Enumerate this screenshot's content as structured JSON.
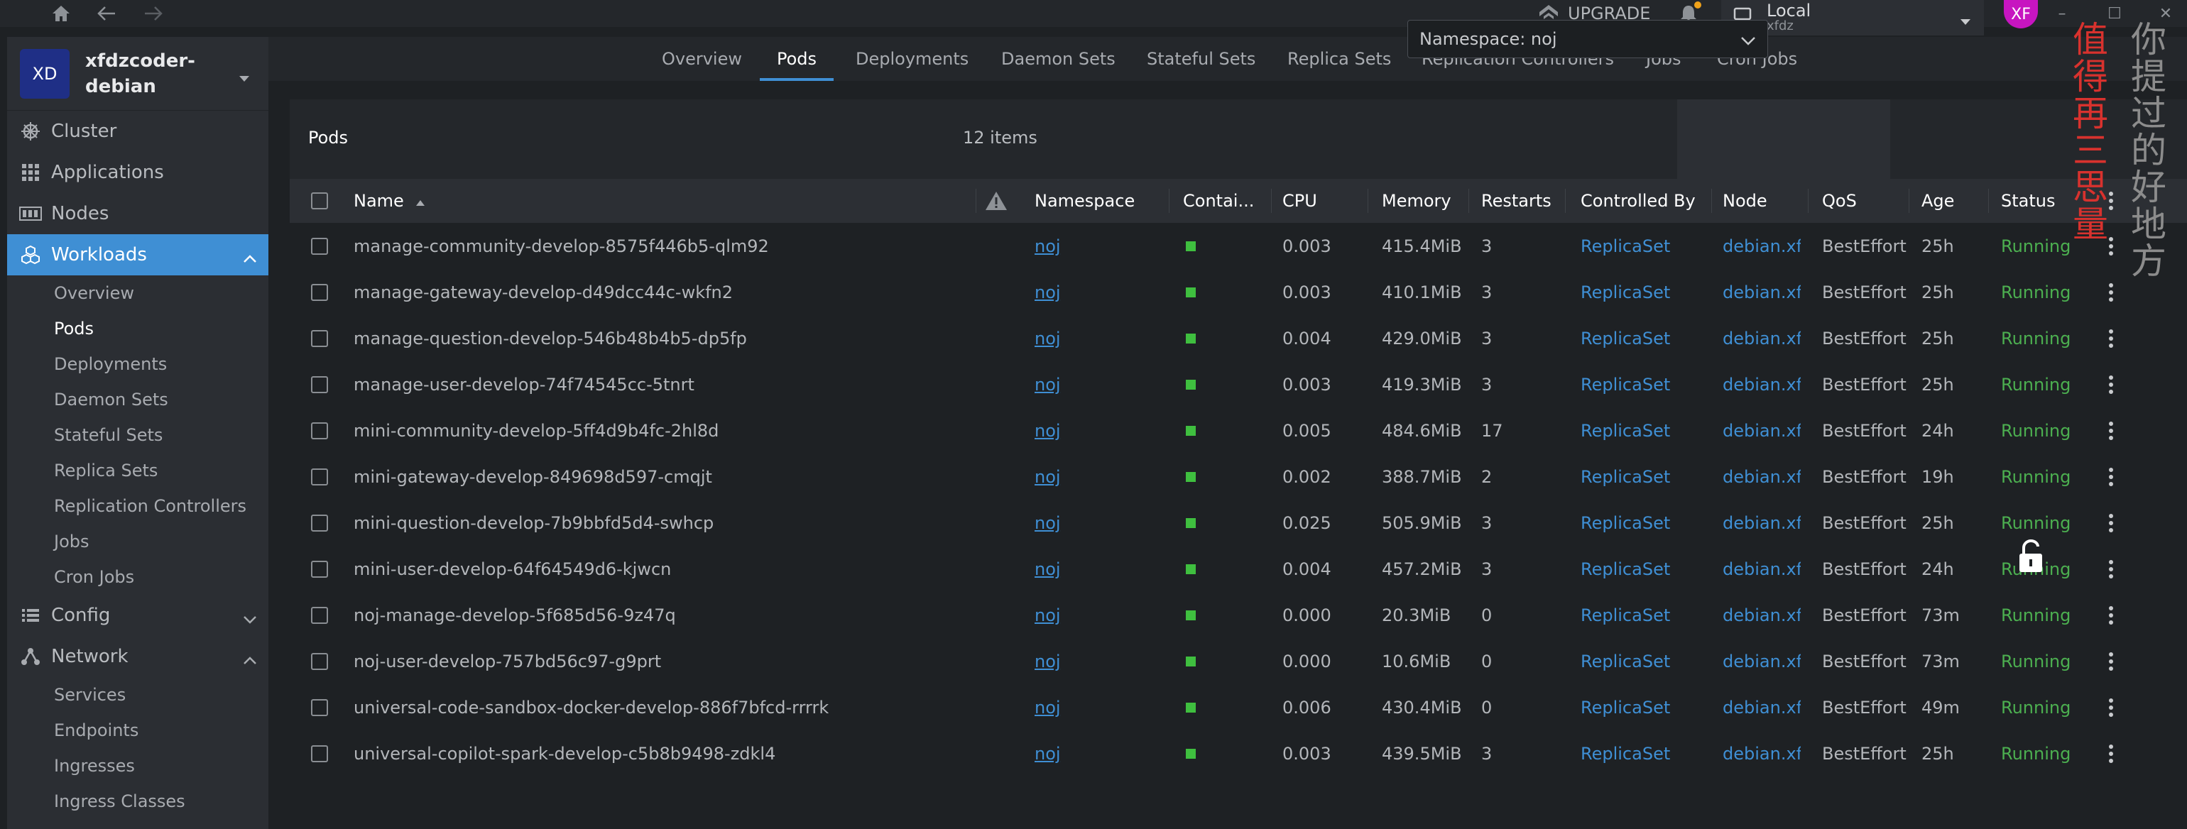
{
  "topbar": {
    "upgrade_label": "UPGRADE",
    "cluster_name": "Local",
    "cluster_user": "xfdz",
    "user_initials": "XF"
  },
  "sidebar": {
    "cluster_initials": "XD",
    "cluster_name": "xfdzcoder-debian",
    "items": [
      {
        "label": "Cluster"
      },
      {
        "label": "Applications"
      },
      {
        "label": "Nodes"
      },
      {
        "label": "Workloads"
      }
    ],
    "workloads_children": [
      {
        "label": "Overview"
      },
      {
        "label": "Pods"
      },
      {
        "label": "Deployments"
      },
      {
        "label": "Daemon Sets"
      },
      {
        "label": "Stateful Sets"
      },
      {
        "label": "Replica Sets"
      },
      {
        "label": "Replication Controllers"
      },
      {
        "label": "Jobs"
      },
      {
        "label": "Cron Jobs"
      }
    ],
    "config_label": "Config",
    "network_label": "Network",
    "network_children": [
      {
        "label": "Services"
      },
      {
        "label": "Endpoints"
      },
      {
        "label": "Ingresses"
      },
      {
        "label": "Ingress Classes"
      }
    ]
  },
  "tabs": [
    {
      "label": "Overview"
    },
    {
      "label": "Pods"
    },
    {
      "label": "Deployments"
    },
    {
      "label": "Daemon Sets"
    },
    {
      "label": "Stateful Sets"
    },
    {
      "label": "Replica Sets"
    },
    {
      "label": "Replication Controllers"
    },
    {
      "label": "Jobs"
    },
    {
      "label": "Cron Jobs"
    }
  ],
  "panel": {
    "title": "Pods",
    "count": "12 items",
    "namespace_filter": "Namespace: noj"
  },
  "columns": {
    "name": "Name",
    "namespace": "Namespace",
    "containers": "Contai...",
    "cpu": "CPU",
    "memory": "Memory",
    "restarts": "Restarts",
    "controlled_by": "Controlled By",
    "node": "Node",
    "qos": "QoS",
    "age": "Age",
    "status": "Status"
  },
  "rows": [
    {
      "name": "manage-community-develop-8575f446b5-qlm92",
      "namespace": "noj",
      "cpu": "0.003",
      "memory": "415.4MiB",
      "restarts": "3",
      "controlled_by": "ReplicaSet",
      "node": "debian.xfc",
      "qos": "BestEffort",
      "age": "25h",
      "status": "Running"
    },
    {
      "name": "manage-gateway-develop-d49dcc44c-wkfn2",
      "namespace": "noj",
      "cpu": "0.003",
      "memory": "410.1MiB",
      "restarts": "3",
      "controlled_by": "ReplicaSet",
      "node": "debian.xfc",
      "qos": "BestEffort",
      "age": "25h",
      "status": "Running"
    },
    {
      "name": "manage-question-develop-546b48b4b5-dp5fp",
      "namespace": "noj",
      "cpu": "0.004",
      "memory": "429.0MiB",
      "restarts": "3",
      "controlled_by": "ReplicaSet",
      "node": "debian.xfc",
      "qos": "BestEffort",
      "age": "25h",
      "status": "Running"
    },
    {
      "name": "manage-user-develop-74f74545cc-5tnrt",
      "namespace": "noj",
      "cpu": "0.003",
      "memory": "419.3MiB",
      "restarts": "3",
      "controlled_by": "ReplicaSet",
      "node": "debian.xfc",
      "qos": "BestEffort",
      "age": "25h",
      "status": "Running"
    },
    {
      "name": "mini-community-develop-5ff4d9b4fc-2hl8d",
      "namespace": "noj",
      "cpu": "0.005",
      "memory": "484.6MiB",
      "restarts": "17",
      "controlled_by": "ReplicaSet",
      "node": "debian.xfc",
      "qos": "BestEffort",
      "age": "24h",
      "status": "Running"
    },
    {
      "name": "mini-gateway-develop-849698d597-cmqjt",
      "namespace": "noj",
      "cpu": "0.002",
      "memory": "388.7MiB",
      "restarts": "2",
      "controlled_by": "ReplicaSet",
      "node": "debian.xfc",
      "qos": "BestEffort",
      "age": "19h",
      "status": "Running"
    },
    {
      "name": "mini-question-develop-7b9bbfd5d4-swhcp",
      "namespace": "noj",
      "cpu": "0.025",
      "memory": "505.9MiB",
      "restarts": "3",
      "controlled_by": "ReplicaSet",
      "node": "debian.xfc",
      "qos": "BestEffort",
      "age": "25h",
      "status": "Running"
    },
    {
      "name": "mini-user-develop-64f64549d6-kjwcn",
      "namespace": "noj",
      "cpu": "0.004",
      "memory": "457.2MiB",
      "restarts": "3",
      "controlled_by": "ReplicaSet",
      "node": "debian.xfc",
      "qos": "BestEffort",
      "age": "24h",
      "status": "Running"
    },
    {
      "name": "noj-manage-develop-5f685d56-9z47q",
      "namespace": "noj",
      "cpu": "0.000",
      "memory": "20.3MiB",
      "restarts": "0",
      "controlled_by": "ReplicaSet",
      "node": "debian.xfc",
      "qos": "BestEffort",
      "age": "73m",
      "status": "Running"
    },
    {
      "name": "noj-user-develop-757bd56c97-g9prt",
      "namespace": "noj",
      "cpu": "0.000",
      "memory": "10.6MiB",
      "restarts": "0",
      "controlled_by": "ReplicaSet",
      "node": "debian.xfc",
      "qos": "BestEffort",
      "age": "73m",
      "status": "Running"
    },
    {
      "name": "universal-code-sandbox-docker-develop-886f7bfcd-rrrrk",
      "namespace": "noj",
      "cpu": "0.006",
      "memory": "430.4MiB",
      "restarts": "0",
      "controlled_by": "ReplicaSet",
      "node": "debian.xfc",
      "qos": "BestEffort",
      "age": "49m",
      "status": "Running"
    },
    {
      "name": "universal-copilot-spark-develop-c5b8b9498-zdkl4",
      "namespace": "noj",
      "cpu": "0.003",
      "memory": "439.5MiB",
      "restarts": "3",
      "controlled_by": "ReplicaSet",
      "node": "debian.xfc",
      "qos": "BestEffort",
      "age": "25h",
      "status": "Running"
    }
  ],
  "watermark": {
    "red": "值得再三思量",
    "gray": "你提过的好地方"
  },
  "colors": {
    "accent": "#3f8fd4",
    "running": "#4caf50",
    "container_ok": "#3fbf3f",
    "avatar": "#c715c0"
  }
}
